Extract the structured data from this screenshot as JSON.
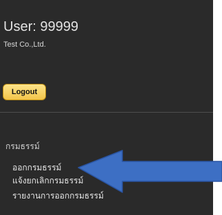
{
  "account": {
    "user_label": "User: 99999",
    "company": "Test Co.,Ltd."
  },
  "actions": {
    "logout_label": "Logout"
  },
  "menu": {
    "heading": "กรมธรรม์",
    "items": [
      {
        "label": "ออกกรมธรรม์"
      },
      {
        "label": "แจ้งยกเลิกกรมธรรม์"
      },
      {
        "label": "รายงานการออกกรมธรรม์"
      }
    ]
  },
  "colors": {
    "panel_background": "#2a2a2a",
    "logout_button": "#f3c54a",
    "annotation_arrow": "#3d6fc4"
  }
}
